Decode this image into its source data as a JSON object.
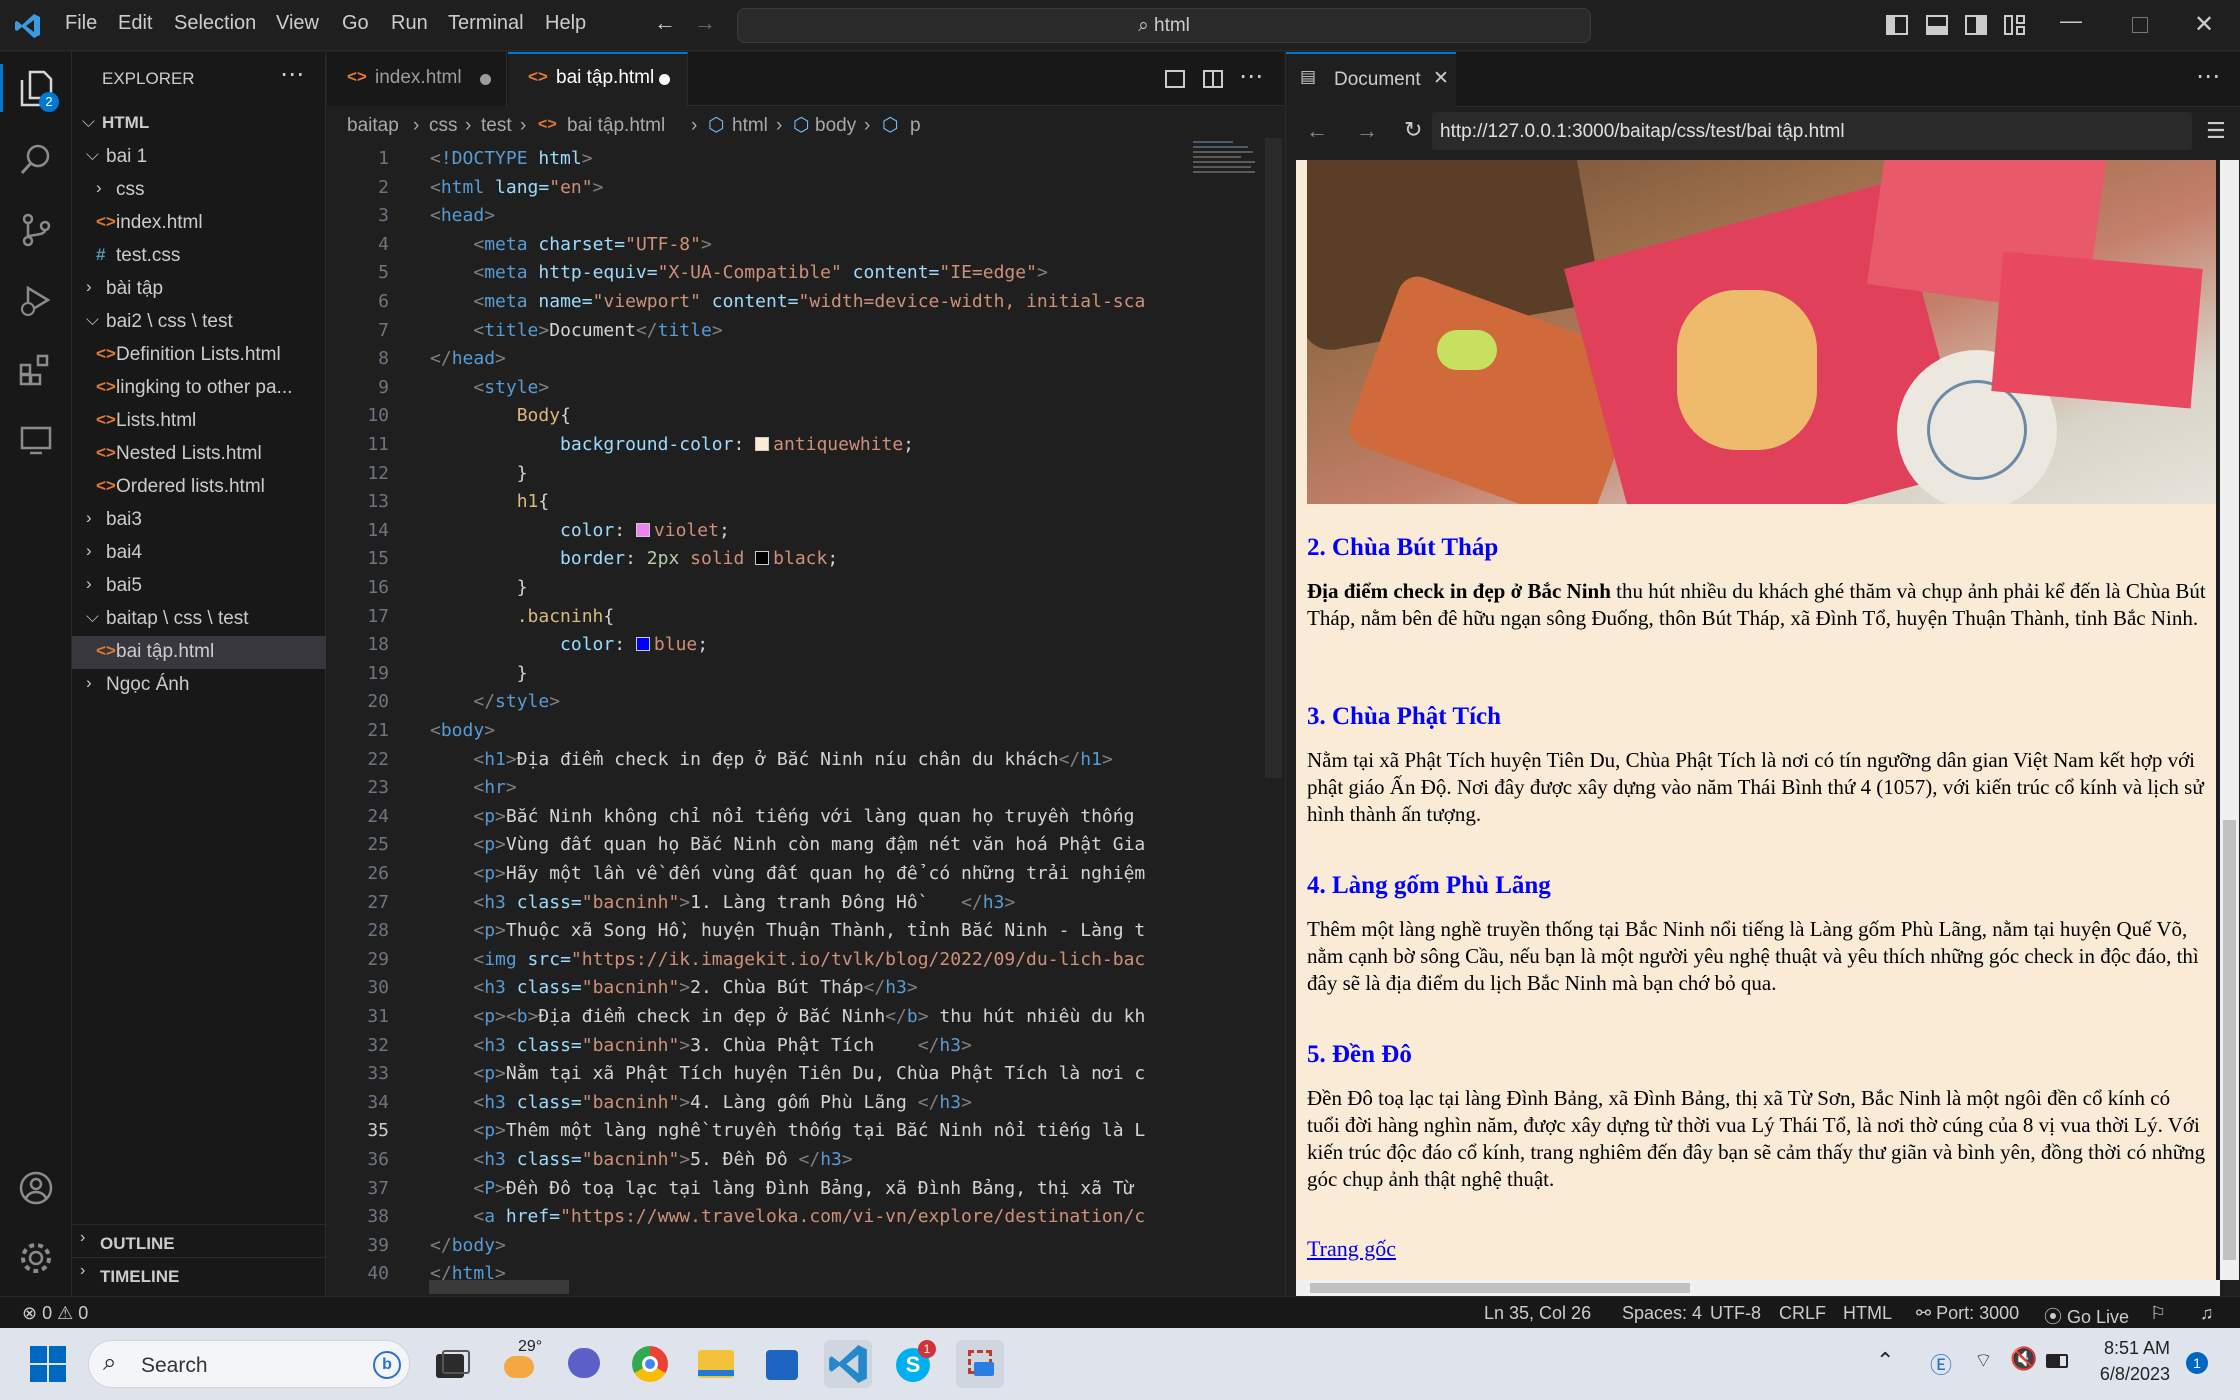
{
  "menu": [
    "File",
    "Edit",
    "Selection",
    "View",
    "Go",
    "Run",
    "Terminal",
    "Help"
  ],
  "command_center": "html",
  "explorer": {
    "title": "EXPLORER",
    "root": "HTML",
    "items": [
      {
        "label": "bai 1",
        "kind": "folder-open",
        "depth": 1
      },
      {
        "label": "css",
        "kind": "folder",
        "depth": 2
      },
      {
        "label": "index.html",
        "kind": "html",
        "depth": 2
      },
      {
        "label": "test.css",
        "kind": "css",
        "depth": 2
      },
      {
        "label": "bài tập",
        "kind": "folder",
        "depth": 1
      },
      {
        "label": "bai2 \\ css \\ test",
        "kind": "folder-open",
        "depth": 1
      },
      {
        "label": "Definition Lists.html",
        "kind": "html",
        "depth": 2
      },
      {
        "label": "lingking to other pa...",
        "kind": "html",
        "depth": 2
      },
      {
        "label": "Lists.html",
        "kind": "html",
        "depth": 2
      },
      {
        "label": "Nested Lists.html",
        "kind": "html",
        "depth": 2
      },
      {
        "label": "Ordered lists.html",
        "kind": "html",
        "depth": 2
      },
      {
        "label": "bai3",
        "kind": "folder",
        "depth": 1
      },
      {
        "label": "bai4",
        "kind": "folder",
        "depth": 1
      },
      {
        "label": "bai5",
        "kind": "folder",
        "depth": 1
      },
      {
        "label": "baitap \\ css \\ test",
        "kind": "folder-open",
        "depth": 1
      },
      {
        "label": "bai tập.html",
        "kind": "html",
        "depth": 2,
        "selected": true
      },
      {
        "label": "Ngọc Ánh",
        "kind": "folder",
        "depth": 1
      }
    ],
    "outline": "OUTLINE",
    "timeline": "TIMELINE",
    "badge": "2"
  },
  "tabs": [
    {
      "label": "index.html",
      "active": false
    },
    {
      "label": "bai tập.html",
      "active": true
    }
  ],
  "breadcrumb": [
    "baitap",
    "css",
    "test",
    "bai tập.html",
    "html",
    "body",
    "p"
  ],
  "code_lines": [
    "<!DOCTYPE html>",
    "<html lang=\"en\">",
    "<head>",
    "    <meta charset=\"UTF-8\">",
    "    <meta http-equiv=\"X-UA-Compatible\" content=\"IE=edge\">",
    "    <meta name=\"viewport\" content=\"width=device-width, initial-sca",
    "    <title>Document</title>",
    "</head>",
    "    <style>",
    "        Body{",
    "            background-color: antiquewhite;",
    "        }",
    "        h1{",
    "            color: violet;",
    "            border: 2px solid black;",
    "        }",
    "        .bacninh{",
    "            color: blue;",
    "        }",
    "    </style>",
    "<body>",
    "    <h1>Địa điểm check in đẹp ở Bắc Ninh níu chân du khách</h1>",
    "    <hr>",
    "    <p>Bắc Ninh không chỉ nổi tiếng với làng quan họ truyền thống",
    "    <p>Vùng đất quan họ Bắc Ninh còn mang đậm nét văn hoá Phật Gia",
    "    <p>Hãy một lần về đến vùng đất quan họ để có những trải nghiệm",
    "    <h3 class=\"bacninh\">1. Làng tranh Đông Hồ    </h3>",
    "    <p>Thuộc xã Song Hồ, huyện Thuận Thành, tỉnh Bắc Ninh - Làng t",
    "    <img src=\"https://ik.imagekit.io/tvlk/blog/2022/09/du-lich-bac",
    "    <h3 class=\"bacninh\">2. Chùa Bút Tháp</h3>",
    "    <p><b>Địa điểm check in đẹp ở Bắc Ninh</b> thu hút nhiều du kh",
    "    <h3 class=\"bacninh\">3. Chùa Phật Tích    </h3>",
    "    <p>Nằm tại xã Phật Tích huyện Tiên Du, Chùa Phật Tích là nơi c",
    "    <h3 class=\"bacninh\">4. Làng gốm Phù Lãng </h3>",
    "    <p>Thêm một làng nghề truyền thống tại Bắc Ninh nổi tiếng là L",
    "    <h3 class=\"bacninh\">5. Đền Đô </h3>",
    "    <P>Đền Đô toạ lạc tại làng Đình Bảng, xã Đình Bảng, thị xã Từ",
    "    <a href=\"https://www.traveloka.com/vi-vn/explore/destination/c",
    "</body>",
    "</html>"
  ],
  "active_line": 35,
  "preview": {
    "tab_label": "Document",
    "url": "http://127.0.0.1:3000/baitap/css/test/bai tập.html",
    "sections": [
      {
        "heading": "2. Chùa Bút Tháp",
        "bold": "Địa điểm check in đẹp ở Bắc Ninh",
        "text": " thu hút nhiều du khách ghé thăm và chụp ảnh phải kể đến là Chùa Bút Tháp, nằm bên đê hữu ngạn sông Đuống, thôn Bút Tháp, xã Đình Tổ, huyện Thuận Thành, tỉnh Bắc Ninh."
      },
      {
        "heading": "3. Chùa Phật Tích",
        "bold": "",
        "text": "Nằm tại xã Phật Tích huyện Tiên Du, Chùa Phật Tích là nơi có tín ngưỡng dân gian Việt Nam kết hợp với phật giáo Ấn Độ. Nơi đây được xây dựng vào năm Thái Bình thứ 4 (1057), với kiến trúc cổ kính và lịch sử hình thành ấn tượng."
      },
      {
        "heading": "4. Làng gốm Phù Lãng",
        "bold": "",
        "text": "Thêm một làng nghề truyền thống tại Bắc Ninh nổi tiếng là Làng gốm Phù Lãng, nằm tại huyện Quế Võ, nằm cạnh bờ sông Cầu, nếu bạn là một người yêu nghệ thuật và yêu thích những góc check in độc đáo, thì đây sẽ là địa điểm du lịch Bắc Ninh mà bạn chớ bỏ qua."
      },
      {
        "heading": "5. Đền Đô",
        "bold": "",
        "text": "Đền Đô toạ lạc tại làng Đình Bảng, xã Đình Bảng, thị xã Từ Sơn, Bắc Ninh là một ngôi đền cổ kính có tuổi đời hàng nghìn năm, được xây dựng từ thời vua Lý Thái Tổ, là nơi thờ cúng của 8 vị vua thời Lý. Với kiến trúc độc đáo cổ kính, trang nghiêm đến đây bạn sẽ cảm thấy thư giãn và bình yên, đồng thời có những góc chụp ảnh thật nghệ thuật."
      }
    ],
    "link": "Trang gốc"
  },
  "status": {
    "errors": "0",
    "warnings": "0",
    "position": "Ln 35, Col 26",
    "spaces": "Spaces: 4",
    "encoding": "UTF-8",
    "eol": "CRLF",
    "language": "HTML",
    "port": "Port: 3000",
    "golive": "Go Live"
  },
  "taskbar": {
    "search": "Search",
    "weather": "29°",
    "time": "8:51 AM",
    "date": "6/8/2023",
    "skype_badge": "1",
    "notif_badge": "1"
  },
  "colors": {
    "accent": "#0078d4",
    "swatch_antiquewhite": "#faebd7",
    "swatch_violet": "#ee82ee",
    "swatch_black": "#000000",
    "swatch_blue": "#0000ff"
  }
}
